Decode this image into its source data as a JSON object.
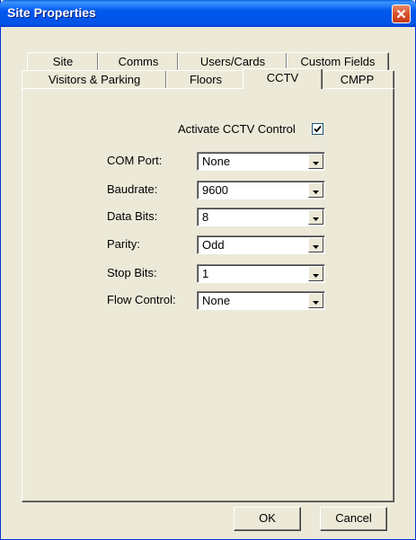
{
  "window": {
    "title": "Site Properties"
  },
  "tabs": {
    "row1": [
      "Site",
      "Comms",
      "Users/Cards",
      "Custom Fields"
    ],
    "row2": [
      "Visitors & Parking",
      "Floors",
      "CCTV",
      "CMPP"
    ],
    "active": "CCTV"
  },
  "cctv": {
    "activate_label": "Activate CCTV Control",
    "activate_checked": true,
    "fields": [
      {
        "label": "COM Port:",
        "value": "None"
      },
      {
        "label": "Baudrate:",
        "value": "9600"
      },
      {
        "label": "Data Bits:",
        "value": "8"
      },
      {
        "label": "Parity:",
        "value": "Odd"
      },
      {
        "label": "Stop Bits:",
        "value": "1"
      },
      {
        "label": "Flow Control:",
        "value": "None"
      }
    ]
  },
  "buttons": {
    "ok": "OK",
    "cancel": "Cancel"
  },
  "icons": {
    "close": "close-icon",
    "dropdown": "chevron-down-icon",
    "check": "checkmark-icon"
  },
  "colors": {
    "titlebar": "#0058ee",
    "face": "#ece9d8",
    "close": "#d8522c"
  }
}
